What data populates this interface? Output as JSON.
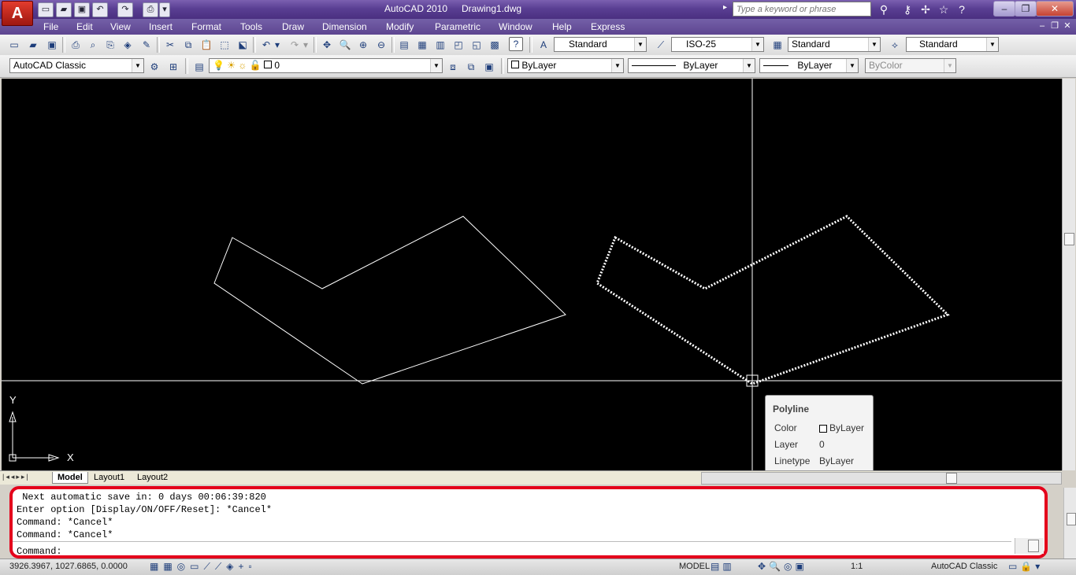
{
  "app": {
    "logo_letter": "A",
    "title": "AutoCAD 2010",
    "file": "Drawing1.dwg",
    "search_placeholder": "Type a keyword or phrase"
  },
  "menu": [
    "File",
    "Edit",
    "View",
    "Insert",
    "Format",
    "Tools",
    "Draw",
    "Dimension",
    "Modify",
    "Parametric",
    "Window",
    "Help",
    "Express"
  ],
  "styles_toolbar": {
    "text_style": "Standard",
    "dim_style": "ISO-25",
    "table_style": "Standard",
    "multileader_style": "Standard"
  },
  "workspace": "AutoCAD Classic",
  "layer": {
    "current": "0"
  },
  "properties": {
    "color": "ByLayer",
    "linetype": "ByLayer",
    "lineweight": "ByLayer",
    "plotstyle": "ByColor"
  },
  "ucs": {
    "x_label": "X",
    "y_label": "Y"
  },
  "tooltip": {
    "title": "Polyline",
    "rows": [
      {
        "key": "Color",
        "value": "ByLayer",
        "swatch": true
      },
      {
        "key": "Layer",
        "value": "0"
      },
      {
        "key": "Linetype",
        "value": "ByLayer"
      }
    ]
  },
  "tabs": [
    "Model",
    "Layout1",
    "Layout2"
  ],
  "command_history": [
    " Next automatic save in: 0 days 00:06:39:820",
    "Enter option [Display/ON/OFF/Reset]: *Cancel*",
    "Command: *Cancel*",
    "Command: *Cancel*"
  ],
  "command_prompt": "Command:",
  "status": {
    "coords": "3926.3967, 1027.6865, 0.0000",
    "model_label": "MODEL",
    "scale": "1:1",
    "workspace_label": "AutoCAD Classic"
  },
  "colors": {
    "title_bar": "#5a3f93",
    "canvas": "#000000",
    "highlight_frame": "#e4001b"
  }
}
